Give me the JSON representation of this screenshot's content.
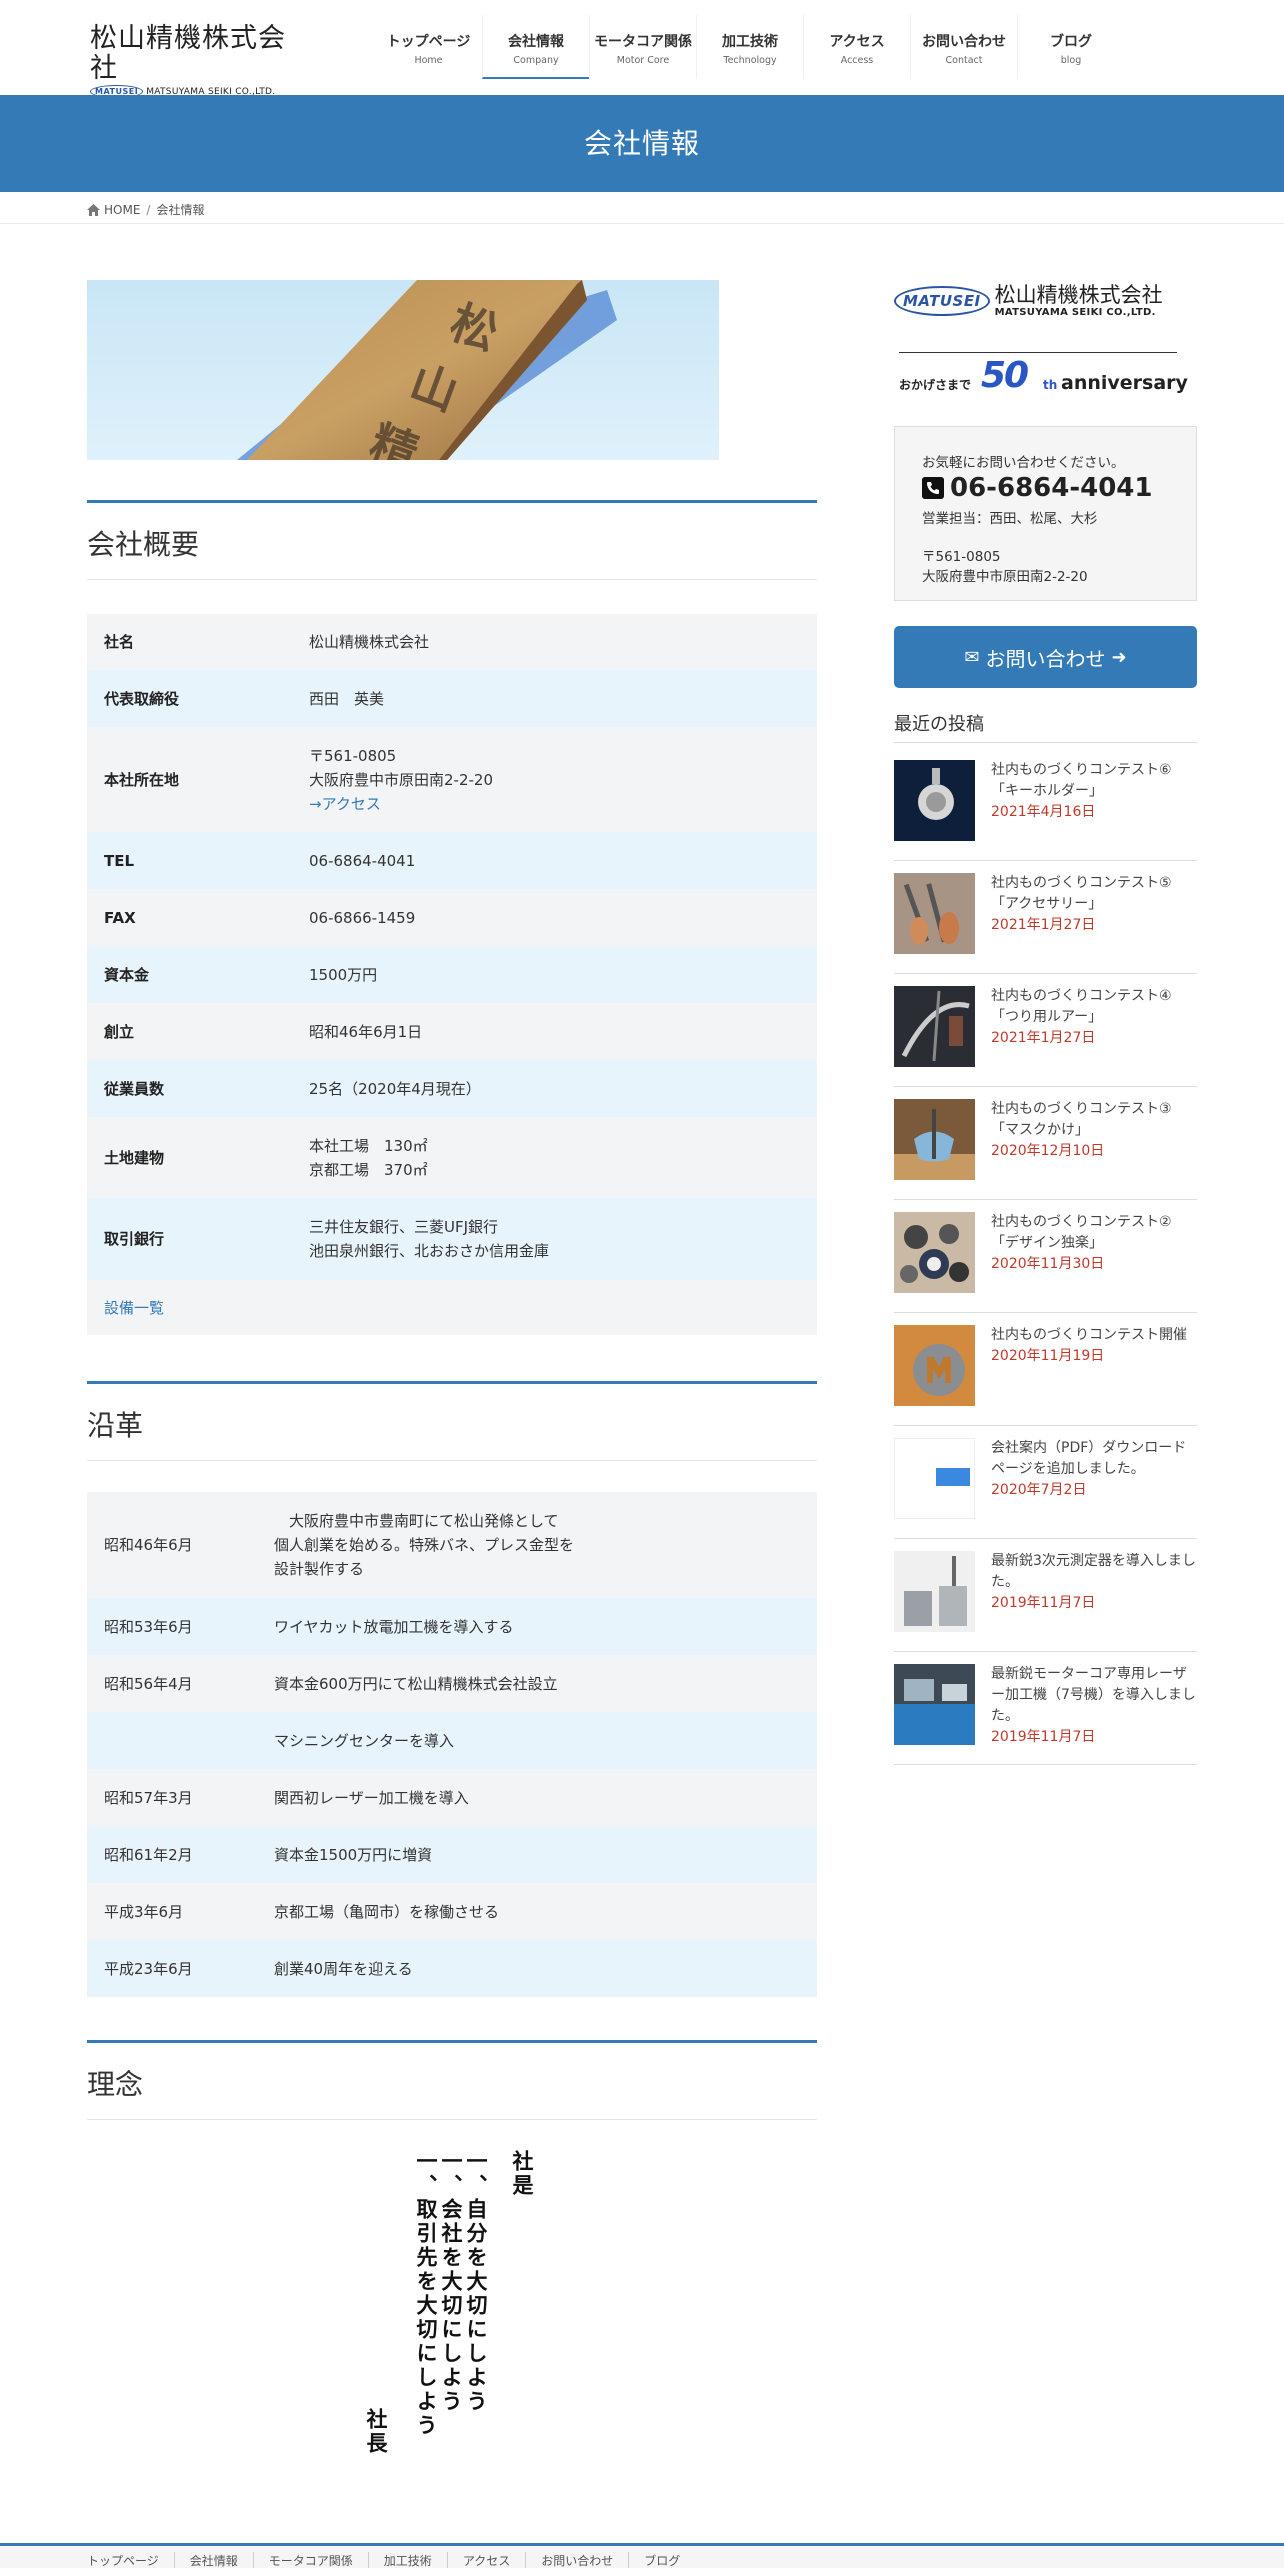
{
  "header": {
    "logo_title": "松山精機株式会社",
    "logo_badge": "MATUSEI",
    "logo_en": "MATSUYAMA SEIKI CO.,LTD.",
    "nav": [
      {
        "jp": "トップページ",
        "en": "Home"
      },
      {
        "jp": "会社情報",
        "en": "Company"
      },
      {
        "jp": "モータコア関係",
        "en": "Motor Core"
      },
      {
        "jp": "加工技術",
        "en": "Technology"
      },
      {
        "jp": "アクセス",
        "en": "Access"
      },
      {
        "jp": "お問い合わせ",
        "en": "Contact"
      },
      {
        "jp": "ブログ",
        "en": "blog"
      }
    ]
  },
  "page_title": "会社情報",
  "breadcrumb": {
    "home": "HOME",
    "current": "会社情報"
  },
  "overview": {
    "title": "会社概要",
    "rows": [
      {
        "label": "社名",
        "value": "松山精機株式会社"
      },
      {
        "label": "代表取締役",
        "value": "西田　英美"
      },
      {
        "label": "本社所在地",
        "line1": "〒561-0805",
        "line2": "大阪府豊中市原田南2-2-20",
        "link": "→アクセス"
      },
      {
        "label": "TEL",
        "value": "06-6864-4041"
      },
      {
        "label": "FAX",
        "value": "06-6866-1459"
      },
      {
        "label": "資本金",
        "value": "1500万円"
      },
      {
        "label": "創立",
        "value": "昭和46年6月1日"
      },
      {
        "label": "従業員数",
        "value": "25名（2020年4月現在）"
      },
      {
        "label": "土地建物",
        "line1": "本社工場　130㎡",
        "line2": "京都工場　370㎡"
      },
      {
        "label": "取引銀行",
        "line1": "三井住友銀行、三菱UFJ銀行",
        "line2": "池田泉州銀行、北おおさか信用金庫"
      }
    ],
    "equipment_link": "設備一覧"
  },
  "history": {
    "title": "沿革",
    "rows": [
      {
        "date": "昭和46年6月",
        "lines": [
          "　大阪府豊中市豊南町にて松山発條として",
          "個人創業を始める。特殊バネ、プレス金型を",
          "設計製作する"
        ]
      },
      {
        "date": "昭和53年6月",
        "lines": [
          "ワイヤカット放電加工機を導入する"
        ]
      },
      {
        "date": "昭和56年4月",
        "lines": [
          "資本金600万円にて松山精機株式会社設立"
        ]
      },
      {
        "date": "",
        "lines": [
          "マシニングセンターを導入"
        ]
      },
      {
        "date": "昭和57年3月",
        "lines": [
          "関西初レーザー加工機を導入"
        ]
      },
      {
        "date": "昭和61年2月",
        "lines": [
          "資本金1500万円に増資"
        ]
      },
      {
        "date": "平成3年6月",
        "lines": [
          "京都工場（亀岡市）を稼働させる"
        ]
      },
      {
        "date": "平成23年6月",
        "lines": [
          "創業40周年を迎える"
        ]
      }
    ]
  },
  "philosophy": {
    "title": "理念",
    "heading": "社是",
    "lines": [
      "一、自分を大切にしよう",
      "一、会社を大切にしよう",
      "一、取引先を大切にしよう"
    ],
    "signature": "社長"
  },
  "sidebar": {
    "logo_badge": "MATUSEI",
    "logo_jp": "松山精機株式会社",
    "logo_en": "MATSUYAMA SEIKI CO.,LTD.",
    "anniv_prefix": "おかげさまで",
    "anniv_number": "50",
    "anniv_suffix": "th",
    "anniv_word": "anniversary",
    "contact": {
      "lead": "お気軽にお問い合わせください。",
      "tel": "06-6864-4041",
      "staff": "営業担当：西田、松尾、大杉",
      "zip": "〒561-0805",
      "address": "大阪府豊中市原田南2-2-20"
    },
    "contact_button": "お問い合わせ",
    "recent_title": "最近の投稿",
    "posts": [
      {
        "title": "社内ものづくりコンテスト⑥「キーホルダー」",
        "date": "2021年4月16日"
      },
      {
        "title": "社内ものづくりコンテスト⑤「アクセサリー」",
        "date": "2021年1月27日"
      },
      {
        "title": "社内ものづくりコンテスト④「つり用ルアー」",
        "date": "2021年1月27日"
      },
      {
        "title": "社内ものづくりコンテスト③「マスクかけ」",
        "date": "2020年12月10日"
      },
      {
        "title": "社内ものづくりコンテスト②「デザイン独楽」",
        "date": "2020年11月30日"
      },
      {
        "title": "社内ものづくりコンテスト開催",
        "date": "2020年11月19日"
      },
      {
        "title": "会社案内（PDF）ダウンロードページを追加しました。",
        "date": "2020年7月2日"
      },
      {
        "title": "最新鋭3次元測定器を導入しました。",
        "date": "2019年11月7日"
      },
      {
        "title": "最新鋭モーターコア専用レーザー加工機（7号機）を導入しました。",
        "date": "2019年11月7日"
      }
    ]
  },
  "footer": {
    "nav": [
      "トップページ",
      "会社情報",
      "モータコア関係",
      "加工技術",
      "アクセス",
      "お問い合わせ",
      "ブログ"
    ]
  },
  "colors": {
    "accent": "#337ab7",
    "date": "#c0392b",
    "row_odd": "#f3f4f5",
    "row_even": "#e8f4fc"
  }
}
